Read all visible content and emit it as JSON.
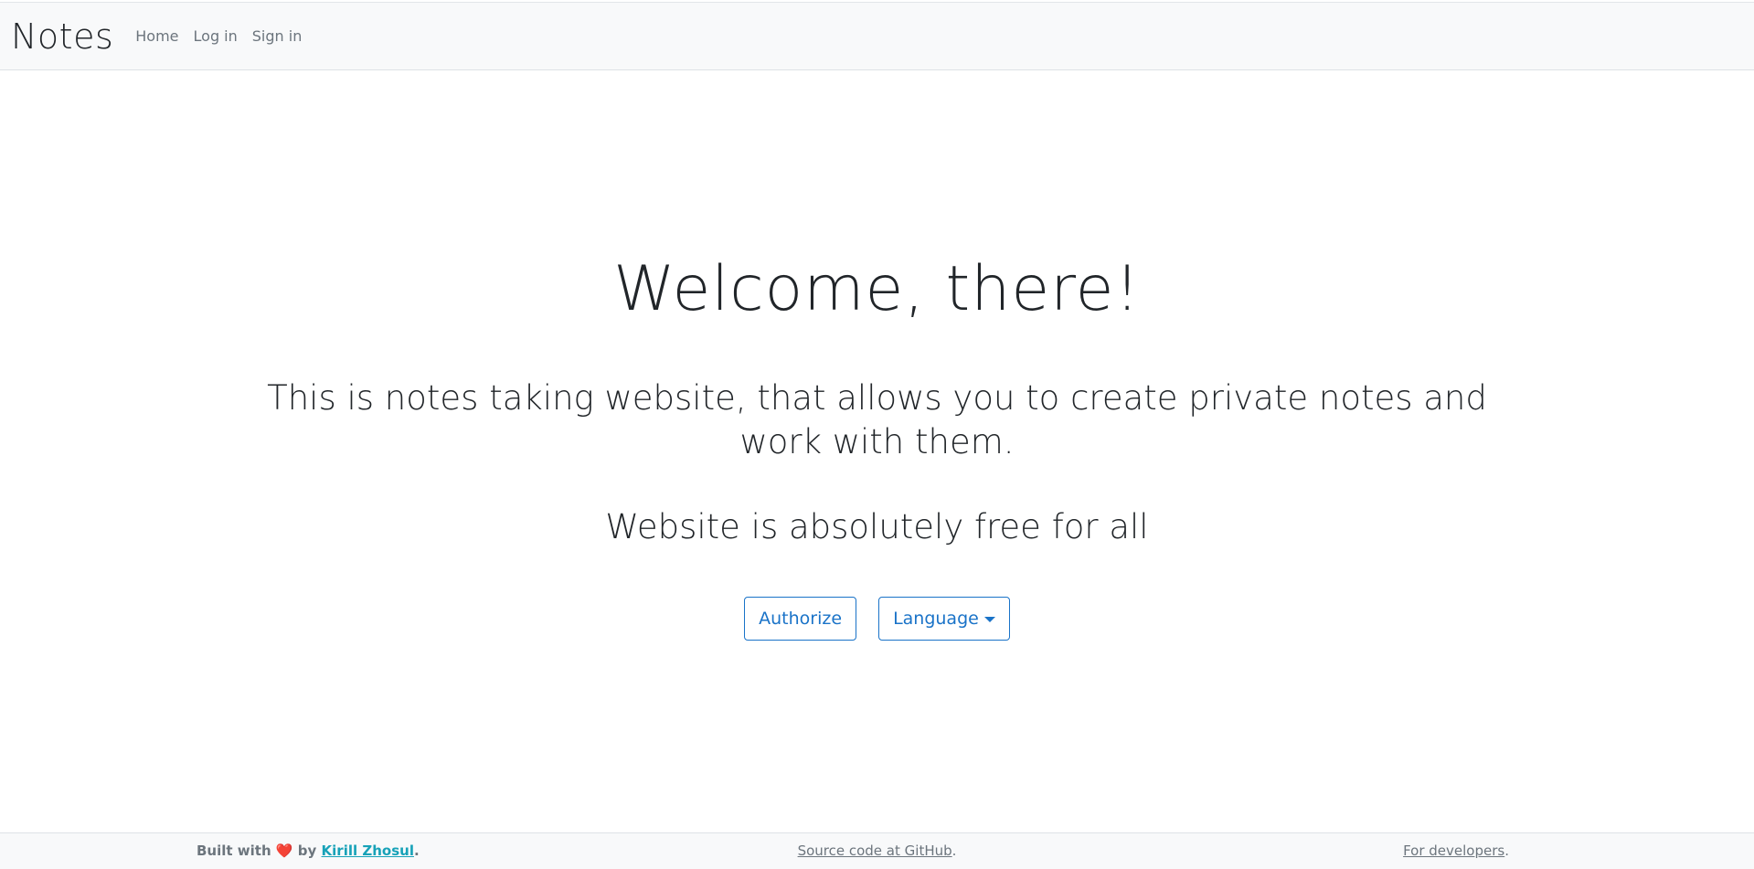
{
  "navbar": {
    "brand": "Notes",
    "links": [
      "Home",
      "Log in",
      "Sign in"
    ]
  },
  "hero": {
    "title": "Welcome, there!",
    "lead": "This is notes taking website, that allows you to create private notes and work with them.",
    "free_text": "Website is absolutely free for all",
    "authorize_label": "Authorize",
    "language_label": "Language"
  },
  "footer": {
    "built_with": "Built with",
    "heart": "❤️",
    "by": "by",
    "author": "Kirill Zhosul",
    "period": ".",
    "source_code": "Source code at GitHub",
    "for_developers": "For developers"
  },
  "colors": {
    "primary": "#1a73c8",
    "navbar_bg": "#f8f9fa",
    "author_link": "#17a2b8",
    "heart": "#e0202f"
  }
}
